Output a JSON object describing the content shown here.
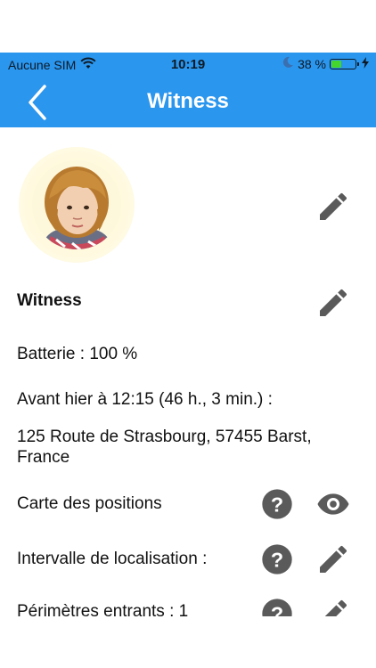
{
  "status_bar": {
    "carrier": "Aucune SIM",
    "time": "10:19",
    "battery_label": "38 %",
    "battery_level": 0.38,
    "icons": [
      "wifi-icon",
      "moon-icon",
      "battery-icon",
      "charging-bolt-icon"
    ]
  },
  "nav": {
    "title": "Witness",
    "back_icon": "chevron-left-icon"
  },
  "profile": {
    "photo_icon": "child-photo",
    "edit_photo_icon": "pencil-icon",
    "name": "Witness",
    "edit_name_icon": "pencil-icon"
  },
  "details": {
    "battery": "Batterie : 100 %",
    "last_seen": "Avant hier à 12:15 (46 h., 3 min.) :",
    "address": "125 Route de Strasbourg, 57455 Barst, France"
  },
  "settings": [
    {
      "label": "Carte des positions",
      "help_icon": "help-circle-icon",
      "action_icon": "eye-icon"
    },
    {
      "label": "Intervalle de localisation :",
      "help_icon": "help-circle-icon",
      "action_icon": "pencil-icon"
    },
    {
      "label": "Périmètres entrants : 1",
      "help_icon": "help-circle-icon",
      "action_icon": "pencil-icon"
    }
  ],
  "colors": {
    "primary": "#2b96ee",
    "icon_gray": "#5a5a5a",
    "battery_green": "#44d62c"
  }
}
